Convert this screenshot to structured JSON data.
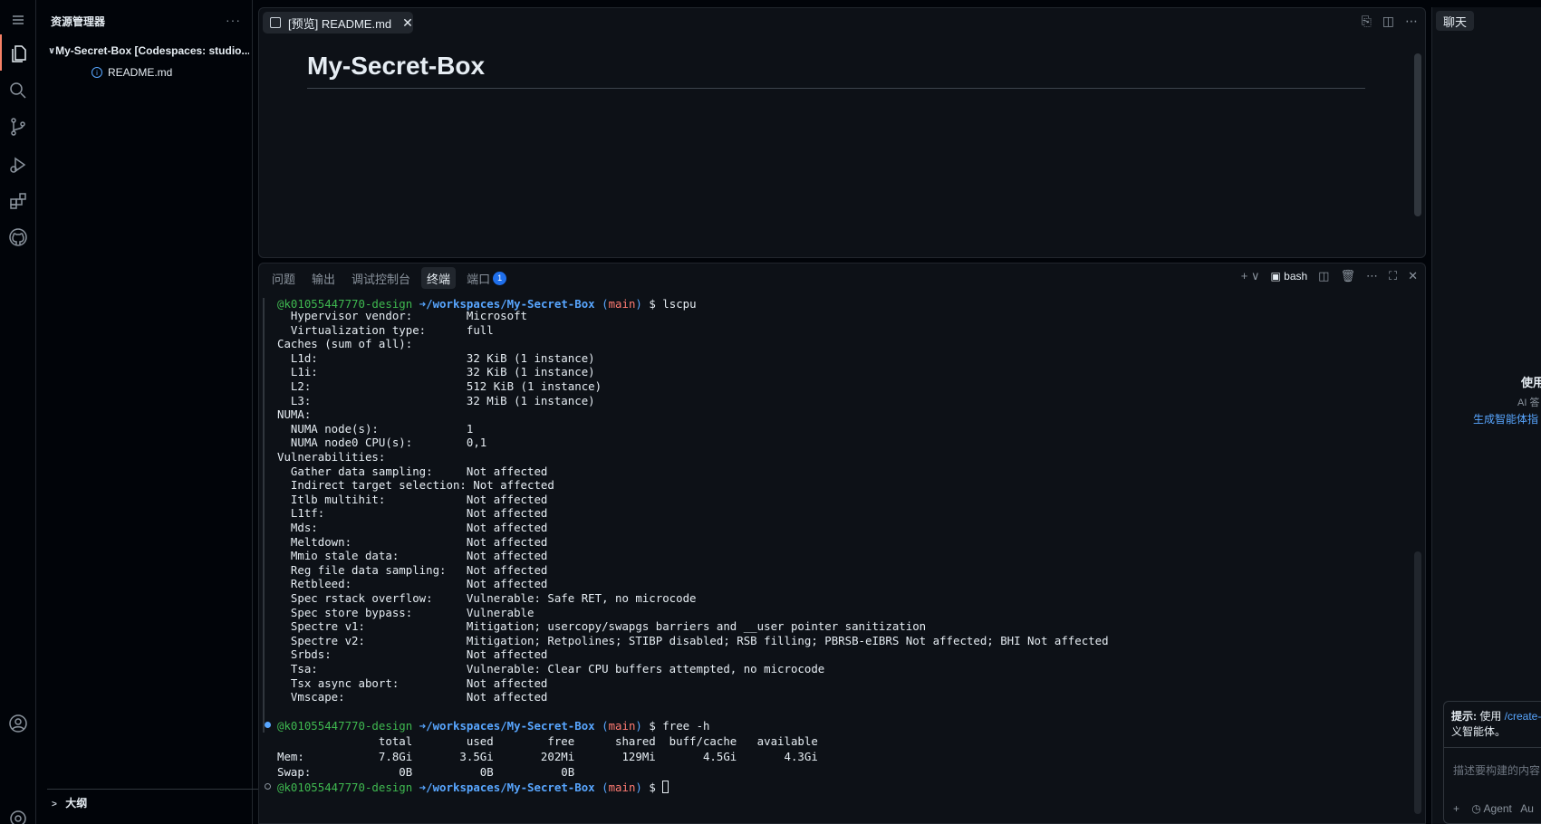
{
  "sidebar": {
    "title": "资源管理器",
    "more": "···",
    "folder": "My-Secret-Box [Codespaces: studio...",
    "file": "README.md",
    "outline": "大纲"
  },
  "editor": {
    "tab_label": "[预览] README.md",
    "heading": "My-Secret-Box"
  },
  "panel": {
    "tabs": [
      "问题",
      "输出",
      "调试控制台",
      "终端",
      "端口"
    ],
    "ports_badge": "1",
    "shell": "bash"
  },
  "terminal": {
    "user": "@k01055447770-design",
    "arrow": "➜",
    "path": "/workspaces/My-Secret-Box",
    "branch": "main",
    "cmd1": "lscpu",
    "cmd2": "free -h",
    "lines": [
      "  Hypervisor vendor:        Microsoft",
      "  Virtualization type:      full",
      "Caches (sum of all):",
      "  L1d:                      32 KiB (1 instance)",
      "  L1i:                      32 KiB (1 instance)",
      "  L2:                       512 KiB (1 instance)",
      "  L3:                       32 MiB (1 instance)",
      "NUMA:",
      "  NUMA node(s):             1",
      "  NUMA node0 CPU(s):        0,1",
      "Vulnerabilities:",
      "  Gather data sampling:     Not affected",
      "  Indirect target selection: Not affected",
      "  Itlb multihit:            Not affected",
      "  L1tf:                     Not affected",
      "  Mds:                      Not affected",
      "  Meltdown:                 Not affected",
      "  Mmio stale data:          Not affected",
      "  Reg file data sampling:   Not affected",
      "  Retbleed:                 Not affected",
      "  Spec rstack overflow:     Vulnerable: Safe RET, no microcode",
      "  Spec store bypass:        Vulnerable",
      "  Spectre v1:               Mitigation; usercopy/swapgs barriers and __user pointer sanitization",
      "  Spectre v2:               Mitigation; Retpolines; STIBP disabled; RSB filling; PBRSB-eIBRS Not affected; BHI Not affected",
      "  Srbds:                    Not affected",
      "  Tsa:                      Vulnerable: Clear CPU buffers attempted, no microcode",
      "  Tsx async abort:          Not affected",
      "  Vmscape:                  Not affected"
    ],
    "free_lines": [
      "               total        used        free      shared  buff/cache   available",
      "Mem:           7.8Gi       3.5Gi       202Mi       129Mi       4.5Gi       4.3Gi",
      "Swap:             0B          0B          0B"
    ]
  },
  "chat": {
    "title": "聊天",
    "use": "使用",
    "ai": "AI 答",
    "link": "生成智能体指",
    "tip_label": "提示:",
    "tip_text": " 使用 ",
    "tip_link": "/create-",
    "tip_rest": "义智能体。",
    "placeholder": "描述要构建的内容",
    "mode": "Agent",
    "mode_extra": "Au"
  }
}
